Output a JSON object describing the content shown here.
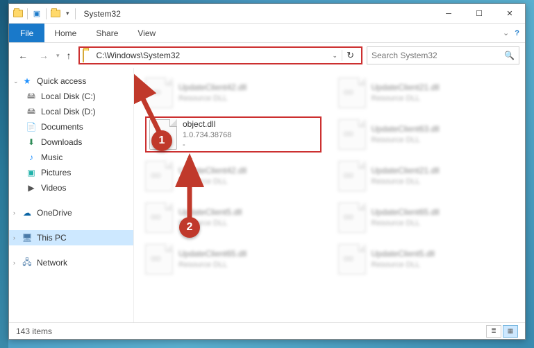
{
  "window": {
    "title": "System32"
  },
  "ribbon": {
    "file": "File",
    "tabs": [
      "Home",
      "Share",
      "View"
    ]
  },
  "nav": {
    "path": "C:\\Windows\\System32",
    "search_placeholder": "Search System32"
  },
  "sidebar": {
    "quick_access": "Quick access",
    "items": [
      {
        "label": "Local Disk (C:)",
        "icon": "disk"
      },
      {
        "label": "Local Disk (D:)",
        "icon": "disk"
      },
      {
        "label": "Documents",
        "icon": "doc"
      },
      {
        "label": "Downloads",
        "icon": "dl"
      },
      {
        "label": "Music",
        "icon": "music"
      },
      {
        "label": "Pictures",
        "icon": "pic"
      },
      {
        "label": "Videos",
        "icon": "vid"
      }
    ],
    "onedrive": "OneDrive",
    "thispc": "This PC",
    "network": "Network"
  },
  "files": {
    "highlighted": {
      "name": "object.dll",
      "version": "1.0.734.38768",
      "desc": "-"
    },
    "blurred": [
      {
        "name": "UpdateClient42.dll",
        "desc": "Resource DLL"
      },
      {
        "name": "UpdateClient21.dll",
        "desc": "Resource DLL"
      },
      {
        "name": "UpdateClient63.dll",
        "desc": "Resource DLL"
      },
      {
        "name": "UpdateClient42.dll",
        "desc": "Resource DLL"
      },
      {
        "name": "UpdateClient21.dll",
        "desc": "Resource DLL"
      },
      {
        "name": "UpdateClient5.dll",
        "desc": "Resource DLL"
      },
      {
        "name": "UpdateClient65.dll",
        "desc": "Resource DLL"
      },
      {
        "name": "UpdateClient65.dll",
        "desc": "Resource DLL"
      },
      {
        "name": "UpdateClient5.dll",
        "desc": "Resource DLL"
      }
    ]
  },
  "status": {
    "count": "143 items"
  },
  "annotations": {
    "marker1": "1",
    "marker2": "2"
  }
}
